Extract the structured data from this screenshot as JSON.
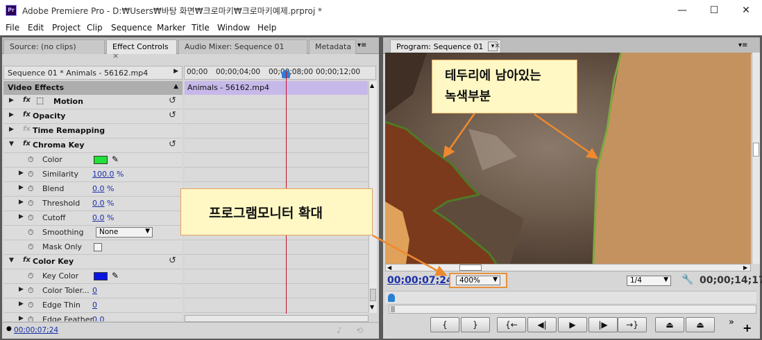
{
  "titlebar": {
    "app_icon": "Pr",
    "title": "Adobe Premiere Pro - D:₩Users₩바탕 화면₩크로마키₩크로마키예제.prproj *",
    "minimize": "—",
    "maximize": "☐",
    "close": "✕"
  },
  "menu": [
    "File",
    "Edit",
    "Project",
    "Clip",
    "Sequence",
    "Marker",
    "Title",
    "Window",
    "Help"
  ],
  "left_tabs": {
    "source": "Source: (no clips)",
    "effect_controls": "Effect Controls",
    "effect_controls_close": "×",
    "audio_mixer": "Audio Mixer: Sequence 01",
    "metadata": "Metadata",
    "menu_icon": "▾≡"
  },
  "effect_controls": {
    "clip_header": "Sequence 01 * Animals - 56162.mp4",
    "ruler_ticks": [
      "00;00",
      "00;00;04;00",
      "00;00;08;00",
      "00;00;12;00"
    ],
    "clip_bar": "Animals - 56162.mp4",
    "section": "Video Effects",
    "rows": {
      "motion": "Motion",
      "opacity": "Opacity",
      "time_remap": "Time Remapping",
      "chroma_key": "Chroma Key",
      "color": "Color",
      "similarity": "Similarity",
      "similarity_val": "100.0",
      "blend": "Blend",
      "blend_val": "0.0",
      "threshold": "Threshold",
      "threshold_val": "0.0",
      "cutoff": "Cutoff",
      "cutoff_val": "0.0",
      "smoothing": "Smoothing",
      "smoothing_val": "None",
      "mask_only": "Mask Only",
      "color_key": "Color Key",
      "key_color": "Key Color",
      "color_tolerance": "Color Toler...",
      "color_tolerance_val": "0",
      "edge_thin": "Edge Thin",
      "edge_thin_val": "0",
      "edge_feather": "Edge Feather",
      "edge_feather_val": "0.0",
      "pct": "%"
    },
    "chroma_color": "#22e03a",
    "key_color_hex": "#0a14e0",
    "footer_timecode": "00;00;07;24"
  },
  "program": {
    "tab": "Program: Sequence 01",
    "tab_dropdown": "▾",
    "tab_close": "×",
    "timecode_left": "00;00;07;24",
    "zoom": "400%",
    "quality": "1/4",
    "timecode_right": "00;00;14;17",
    "controls": [
      "{",
      "}",
      "{←",
      "◀|",
      "▶",
      "|▶",
      "→}",
      "⏏",
      "⏏"
    ],
    "more": "»",
    "add": "+"
  },
  "annotations": {
    "edge_note_line1": "테두리에 남아있는",
    "edge_note_line2": "녹색부분",
    "zoom_note": "프로그램모니터 확대"
  }
}
